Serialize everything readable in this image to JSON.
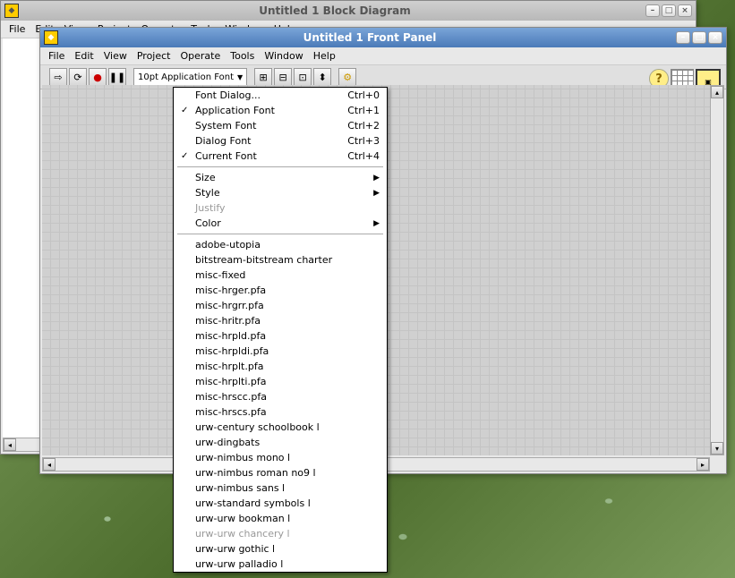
{
  "bd_window": {
    "title": "Untitled 1 Block Diagram",
    "menus": [
      "File",
      "Edit",
      "View",
      "Project",
      "Operate",
      "Tools",
      "Window",
      "Help"
    ]
  },
  "fp_window": {
    "title": "Untitled 1 Front Panel",
    "menus": [
      "File",
      "Edit",
      "View",
      "Project",
      "Operate",
      "Tools",
      "Window",
      "Help"
    ],
    "font_combo": "10pt Application Font"
  },
  "dropdown": {
    "top": [
      {
        "label": "Font Dialog...",
        "shortcut": "Ctrl+0",
        "checked": false
      },
      {
        "label": "Application Font",
        "shortcut": "Ctrl+1",
        "checked": true
      },
      {
        "label": "System Font",
        "shortcut": "Ctrl+2",
        "checked": false
      },
      {
        "label": "Dialog Font",
        "shortcut": "Ctrl+3",
        "checked": false
      },
      {
        "label": "Current Font",
        "shortcut": "Ctrl+4",
        "checked": true
      }
    ],
    "mid": [
      {
        "label": "Size",
        "submenu": true,
        "disabled": false
      },
      {
        "label": "Style",
        "submenu": true,
        "disabled": false
      },
      {
        "label": "Justify",
        "submenu": false,
        "disabled": true
      },
      {
        "label": "Color",
        "submenu": true,
        "disabled": false
      }
    ],
    "fonts": [
      "adobe-utopia",
      "bitstream-bitstream charter",
      "misc-fixed",
      "misc-hrger.pfa",
      "misc-hrgrr.pfa",
      "misc-hritr.pfa",
      "misc-hrpld.pfa",
      "misc-hrpldi.pfa",
      "misc-hrplt.pfa",
      "misc-hrplti.pfa",
      "misc-hrscc.pfa",
      "misc-hrscs.pfa",
      "urw-century schoolbook l",
      "urw-dingbats",
      "urw-nimbus mono l",
      "urw-nimbus roman no9 l",
      "urw-nimbus sans l",
      "urw-standard symbols l",
      "urw-urw bookman l",
      "urw-urw chancery l",
      "urw-urw gothic l",
      "urw-urw palladio l"
    ],
    "disabled_fonts": [
      "urw-urw chancery l"
    ]
  },
  "icons": {
    "run": "⇨",
    "run_cont": "⟳",
    "abort": "●",
    "pause": "❚❚",
    "align": "⊞",
    "distribute": "⊟",
    "resize": "⊡",
    "reorder": "⬍",
    "help": "?",
    "min": "–",
    "max": "□",
    "close": "×",
    "settings": "⚙"
  }
}
